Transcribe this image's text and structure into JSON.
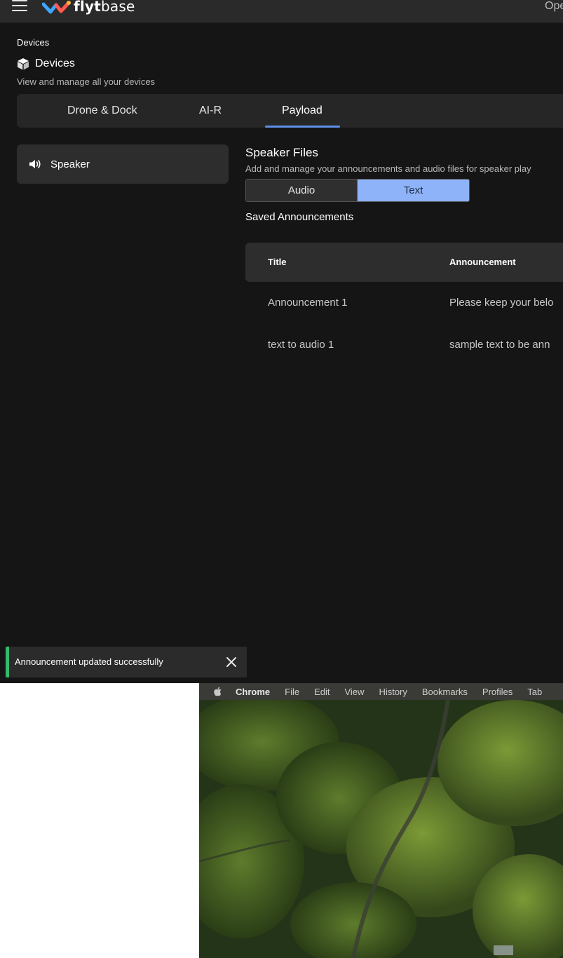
{
  "topbar": {
    "logo_text_bold": "flyt",
    "logo_text_rest": "base",
    "right_text": "Ope"
  },
  "header": {
    "breadcrumb": "Devices",
    "title": "Devices",
    "subtitle": "View and manage all your devices"
  },
  "tabs": [
    {
      "label": "Drone & Dock"
    },
    {
      "label": "AI-R"
    },
    {
      "label": "Payload"
    }
  ],
  "sidebar": {
    "items": [
      {
        "label": "Speaker",
        "icon": "speaker-icon"
      }
    ]
  },
  "main": {
    "title": "Speaker Files",
    "subtitle": "Add and manage your announcements and audio files for speaker play",
    "segments": {
      "audio": "Audio",
      "text": "Text",
      "selected": "Text"
    },
    "saved_title": "Saved Announcements",
    "table": {
      "headers": [
        "Title",
        "Announcement"
      ],
      "rows": [
        [
          "Announcement 1",
          "Please keep your belo"
        ],
        [
          "text to audio 1",
          "sample text to be ann"
        ]
      ]
    }
  },
  "toast": {
    "message": "Announcement updated successfully"
  },
  "menubar": {
    "items": [
      "Chrome",
      "File",
      "Edit",
      "View",
      "History",
      "Bookmarks",
      "Profiles",
      "Tab"
    ]
  },
  "colors": {
    "accent": "#5f8fe9",
    "segment_selected": "#8eb3f8",
    "success": "#35b96b",
    "background": "#151515"
  }
}
